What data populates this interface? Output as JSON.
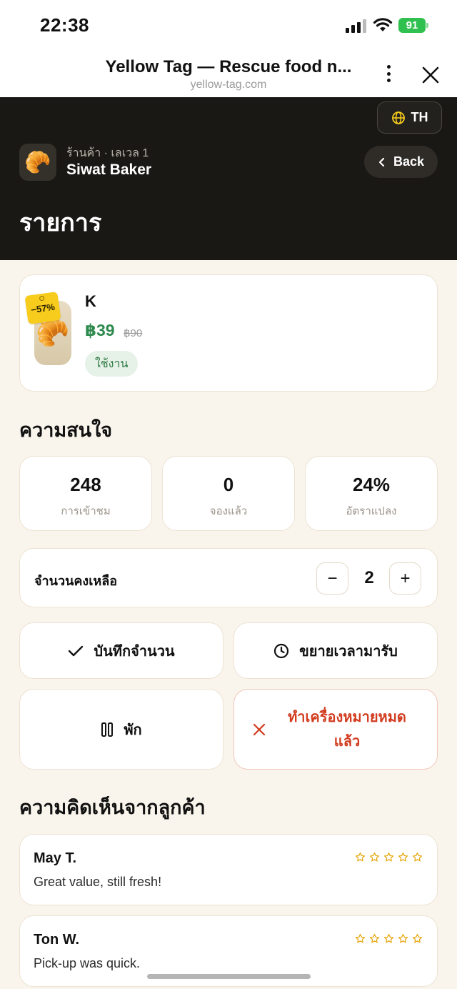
{
  "status_bar": {
    "time": "22:38",
    "battery": "91"
  },
  "browser": {
    "title": "Yellow Tag — Rescue food n...",
    "url": "yellow-tag.com"
  },
  "header": {
    "language": "TH",
    "shop_meta": "ร้านค้า · เลเวล 1",
    "shop_name": "Siwat Baker",
    "back_label": "Back",
    "page_title": "รายการ"
  },
  "product": {
    "name": "K",
    "price": "฿39",
    "old_price": "฿90",
    "discount": "−57%",
    "status": "ใช้งาน",
    "image_icon": "croissant-icon"
  },
  "interest": {
    "title": "ความสนใจ",
    "stats": [
      {
        "value": "248",
        "label": "การเข้าชม"
      },
      {
        "value": "0",
        "label": "จองแล้ว"
      },
      {
        "value": "24%",
        "label": "อัตราแปลง"
      }
    ]
  },
  "quantity": {
    "label": "จำนวนคงเหลือ",
    "value": "2",
    "minus": "−",
    "plus": "+"
  },
  "actions": {
    "save": "บันทึกจำนวน",
    "extend": "ขยายเวลามารับ",
    "pause": "พัก",
    "sold_out": "ทำเครื่องหมายหมดแล้ว"
  },
  "reviews": {
    "title": "ความคิดเห็นจากลูกค้า",
    "items": [
      {
        "name": "May T.",
        "text": "Great value, still fresh!",
        "stars": 5
      },
      {
        "name": "Ton W.",
        "text": "Pick-up was quick.",
        "stars": 5
      }
    ]
  },
  "colors": {
    "accent_yellow": "#f7cc1c",
    "price_green": "#2e8a4e",
    "danger_red": "#d23c1f",
    "header_dark": "#1a1815",
    "star": "#e7a812"
  }
}
